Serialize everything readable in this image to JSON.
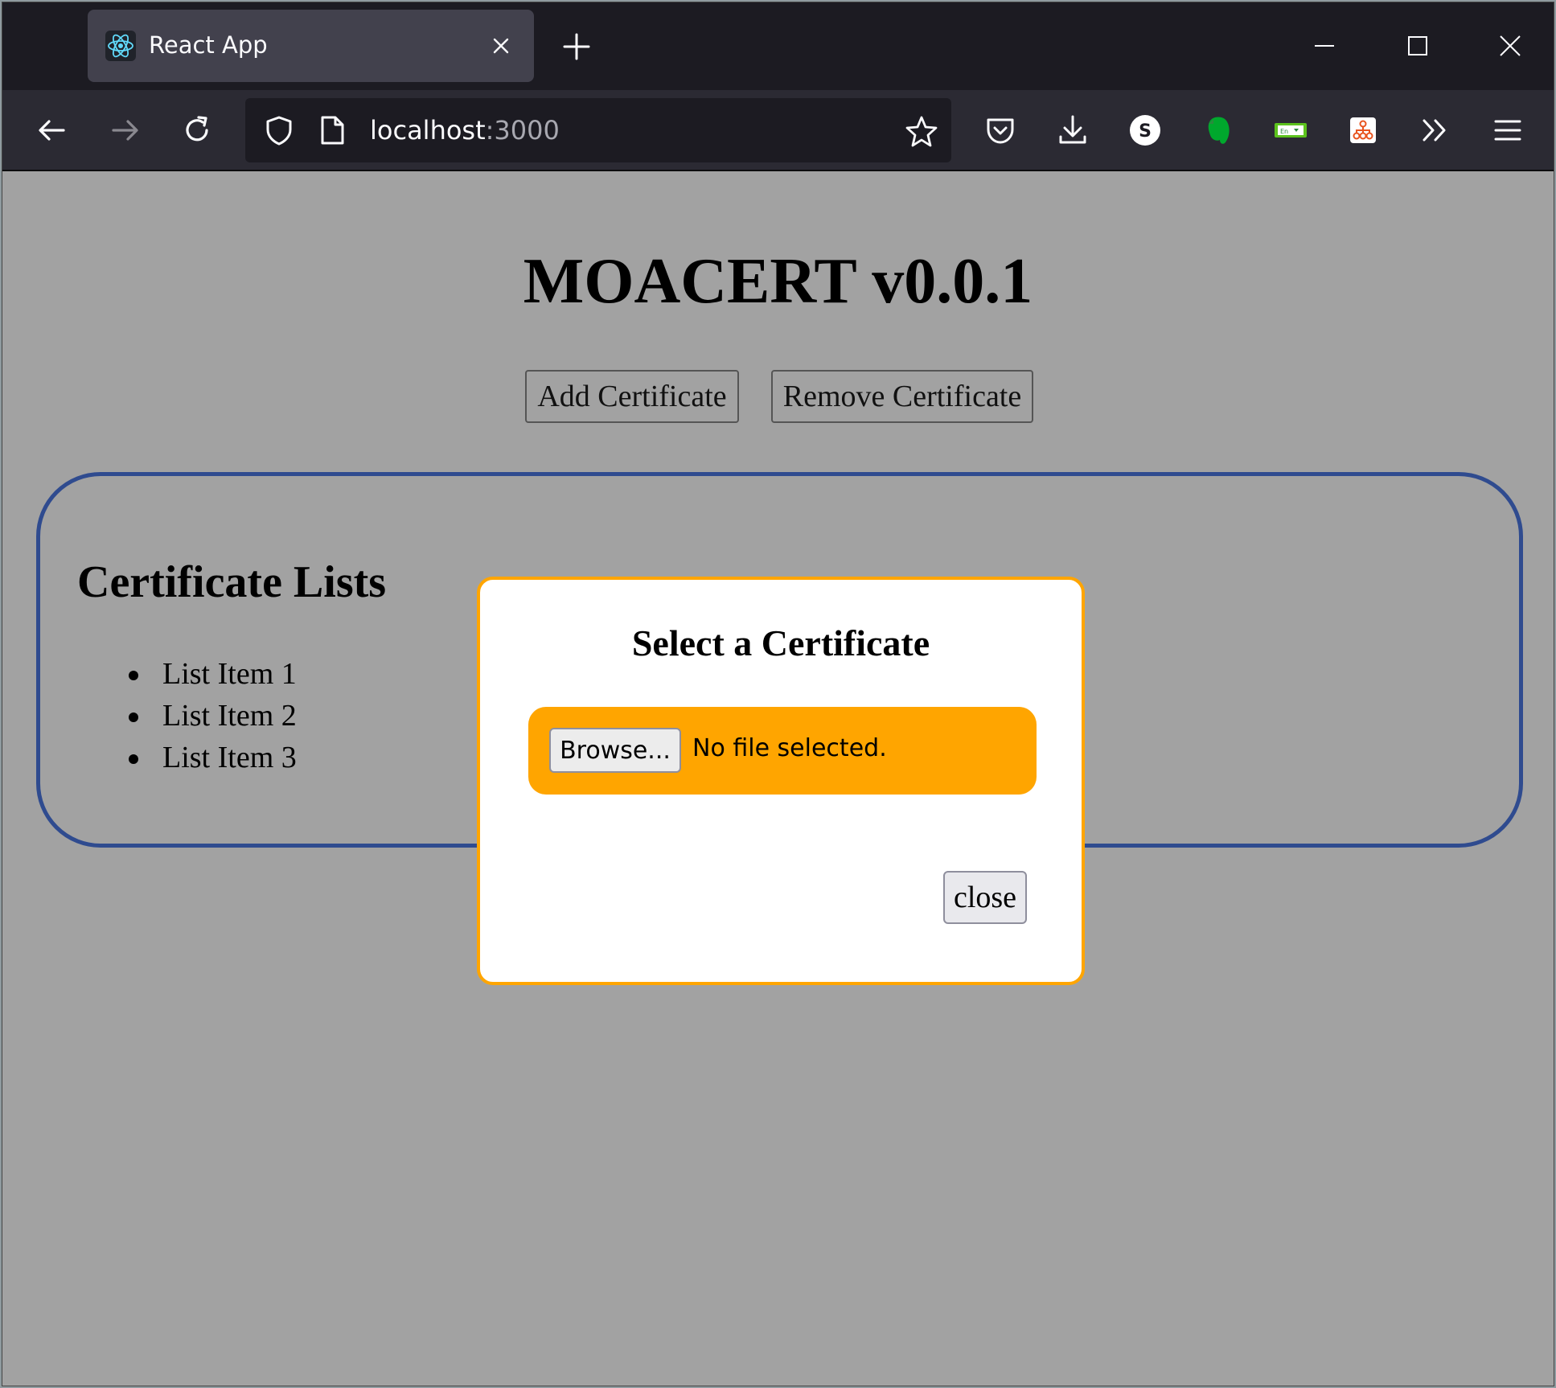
{
  "browser": {
    "tab_title": "React App",
    "url_host": "localhost",
    "url_port": ":3000"
  },
  "app": {
    "title": "MOACERT v0.0.1",
    "add_button": "Add Certificate",
    "remove_button": "Remove Certificate",
    "list_heading": "Certificate Lists",
    "list_items": [
      "List Item 1",
      "List Item 2",
      "List Item 3"
    ]
  },
  "modal": {
    "title": "Select a Certificate",
    "browse_label": "Browse...",
    "file_status": "No file selected.",
    "close_label": "close"
  },
  "colors": {
    "page_background": "#a2a2a2",
    "list_border": "#2f4b8f",
    "modal_accent": "#ffa500"
  }
}
